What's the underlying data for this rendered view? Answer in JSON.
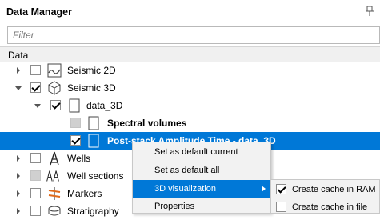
{
  "panel": {
    "title": "Data Manager"
  },
  "filter": {
    "placeholder": "Filter",
    "value": ""
  },
  "tree": {
    "header": "Data",
    "items": [
      {
        "label": "Seismic 2D"
      },
      {
        "label": "Seismic 3D"
      },
      {
        "label": "data_3D"
      },
      {
        "label": "Spectral volumes"
      },
      {
        "label": "Post-stack Amplitude Time - data_3D"
      },
      {
        "label": "Wells"
      },
      {
        "label": "Well sections"
      },
      {
        "label": "Markers"
      },
      {
        "label": "Stratigraphy"
      }
    ]
  },
  "context_menu": {
    "items": [
      {
        "label": "Set as default current"
      },
      {
        "label": "Set as default all"
      },
      {
        "label": "3D visualization"
      },
      {
        "label": "Properties"
      }
    ]
  },
  "submenu": {
    "items": [
      {
        "label": "Create cache in RAM",
        "checked": true
      },
      {
        "label": "Create cache in file",
        "checked": false
      }
    ]
  },
  "colors": {
    "selection": "#0078d7",
    "menu_bg": "#f2f2f2",
    "header_bg": "#f0f0f0"
  }
}
